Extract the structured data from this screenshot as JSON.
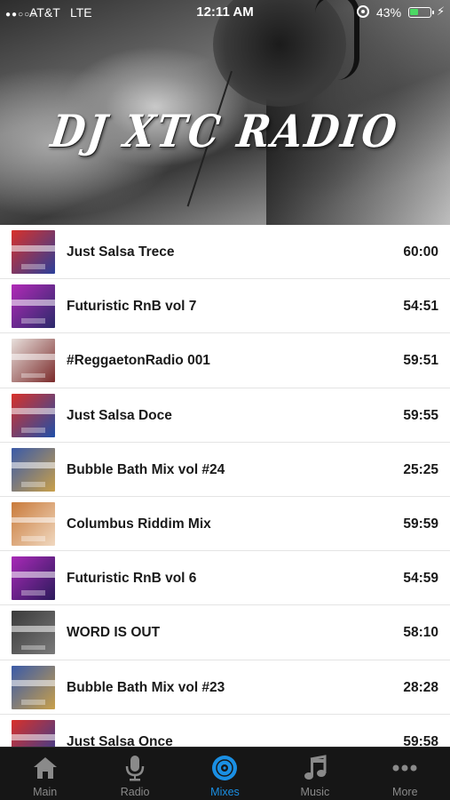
{
  "status_bar": {
    "carrier": "AT&T",
    "network": "LTE",
    "time": "12:11 AM",
    "battery_percent": "43%",
    "battery_level": 0.43
  },
  "header": {
    "title": "DJ XTC RADIO"
  },
  "mixes": [
    {
      "title": "Just Salsa Trece",
      "duration": "60:00",
      "thumb_colors": [
        "#d9312a",
        "#2a3f9a"
      ]
    },
    {
      "title": "Futuristic RnB vol 7",
      "duration": "54:51",
      "thumb_colors": [
        "#b12ab7",
        "#2a2a6a"
      ]
    },
    {
      "title": "#ReggaetonRadio 001",
      "duration": "59:51",
      "thumb_colors": [
        "#e8e0dc",
        "#7a2a2a"
      ]
    },
    {
      "title": "Just Salsa Doce",
      "duration": "59:55",
      "thumb_colors": [
        "#d9312a",
        "#1f4fa8"
      ]
    },
    {
      "title": "Bubble Bath Mix vol #24",
      "duration": "25:25",
      "thumb_colors": [
        "#3a5aa8",
        "#c9a04a"
      ]
    },
    {
      "title": "Columbus Riddim Mix",
      "duration": "59:59",
      "thumb_colors": [
        "#c97a3a",
        "#f0d8c0"
      ]
    },
    {
      "title": "Futuristic RnB vol 6",
      "duration": "54:59",
      "thumb_colors": [
        "#a82ab7",
        "#2a1a5a"
      ]
    },
    {
      "title": "WORD IS OUT",
      "duration": "58:10",
      "thumb_colors": [
        "#3a3a3a",
        "#7a7a7a"
      ]
    },
    {
      "title": "Bubble Bath Mix vol #23",
      "duration": "28:28",
      "thumb_colors": [
        "#3a5aa8",
        "#c9a04a"
      ]
    },
    {
      "title": "Just Salsa Once",
      "duration": "59:58",
      "thumb_colors": [
        "#d9312a",
        "#2a3f9a"
      ]
    }
  ],
  "tabs": [
    {
      "label": "Main",
      "icon": "home-icon",
      "active": false
    },
    {
      "label": "Radio",
      "icon": "microphone-icon",
      "active": false
    },
    {
      "label": "Mixes",
      "icon": "disc-icon",
      "active": true
    },
    {
      "label": "Music",
      "icon": "music-note-icon",
      "active": false
    },
    {
      "label": "More",
      "icon": "more-dots-icon",
      "active": false
    }
  ],
  "colors": {
    "accent": "#1a8fe3",
    "tabbar_bg": "#161616",
    "tab_inactive": "#8a8a8a",
    "battery_fill": "#4cd964"
  }
}
